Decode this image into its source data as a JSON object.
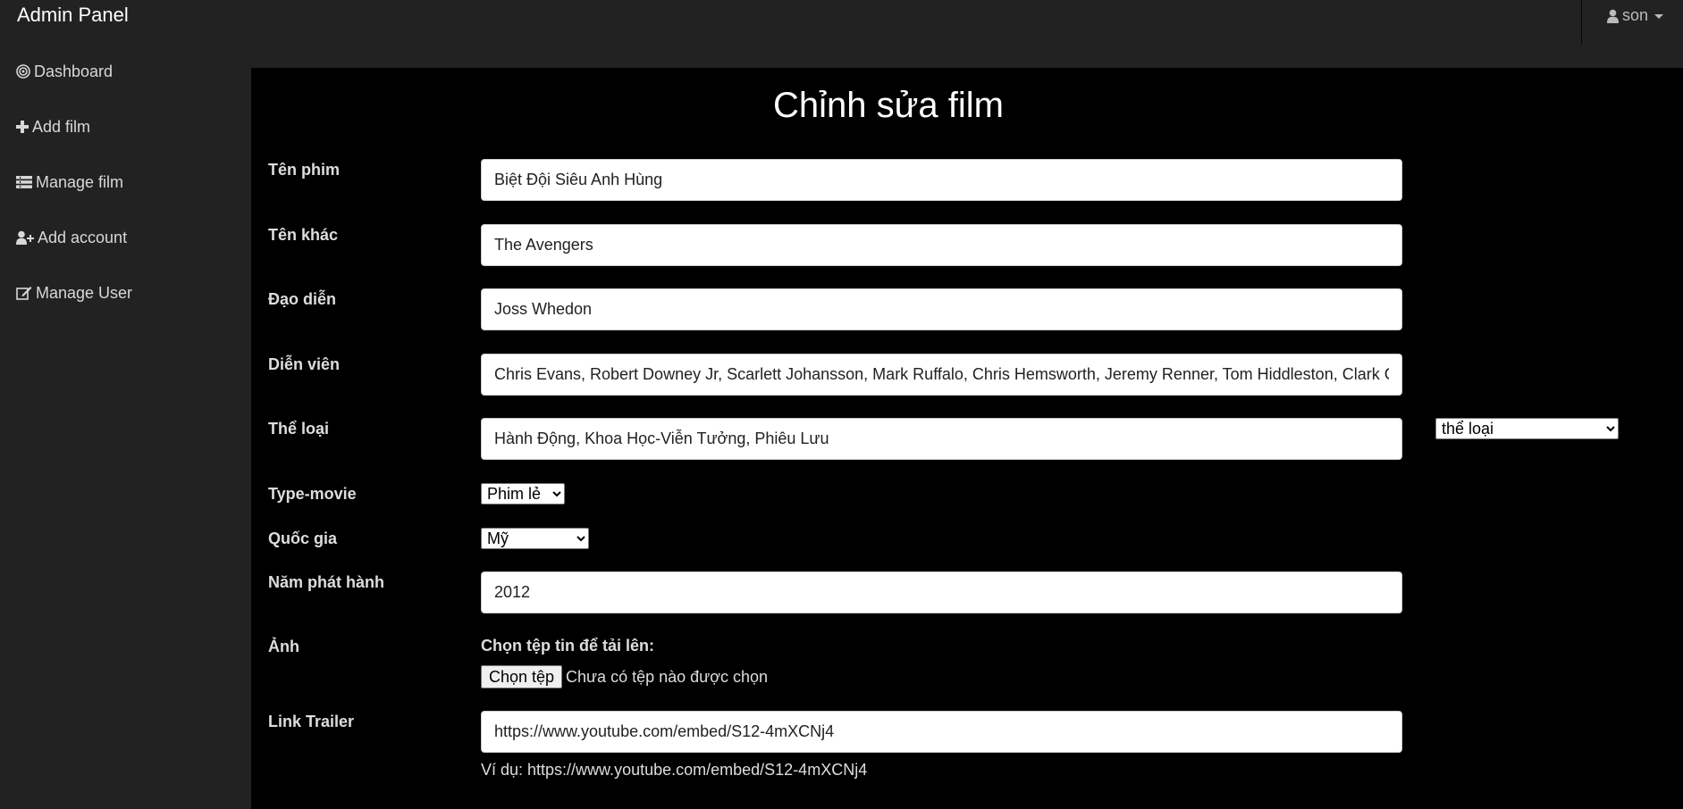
{
  "navbar": {
    "brand": "Admin Panel",
    "user": "son",
    "user_icon": "user-icon"
  },
  "sidebar": {
    "items": [
      {
        "label": "Dashboard",
        "icon": "dashboard-icon"
      },
      {
        "label": "Add film",
        "icon": "plus-icon"
      },
      {
        "label": "Manage film",
        "icon": "list-icon"
      },
      {
        "label": "Add account",
        "icon": "user-plus-icon"
      },
      {
        "label": "Manage User",
        "icon": "edit-icon"
      }
    ]
  },
  "form": {
    "title": "Chỉnh sửa film",
    "name_label": "Tên phim",
    "name_value": "Biệt Đội Siêu Anh Hùng",
    "alt_name_label": "Tên khác",
    "alt_name_value": "The Avengers",
    "director_label": "Đạo diễn",
    "director_value": "Joss Whedon",
    "actors_label": "Diễn viên",
    "actors_value": "Chris Evans, Robert Downey Jr, Scarlett Johansson, Mark Ruffalo, Chris Hemsworth, Jeremy Renner, Tom Hiddleston, Clark Gregg",
    "genre_label": "Thể loại",
    "genre_value": "Hành Động, Khoa Học-Viễn Tưởng, Phiêu Lưu",
    "genre_select": "thể loại",
    "type_label": "Type-movie",
    "type_value": "Phim lẻ",
    "country_label": "Quốc gia",
    "country_value": "Mỹ",
    "year_label": "Năm phát hành",
    "year_value": "2012",
    "image_label": "Ảnh",
    "file_title": "Chọn tệp tin để tải lên:",
    "file_button": "Chọn tệp",
    "file_status": "Chưa có tệp nào được chọn",
    "trailer_label": "Link Trailer",
    "trailer_value": "https://www.youtube.com/embed/S12-4mXCNj4",
    "trailer_hint": "Ví dụ: https://www.youtube.com/embed/S12-4mXCNj4"
  }
}
